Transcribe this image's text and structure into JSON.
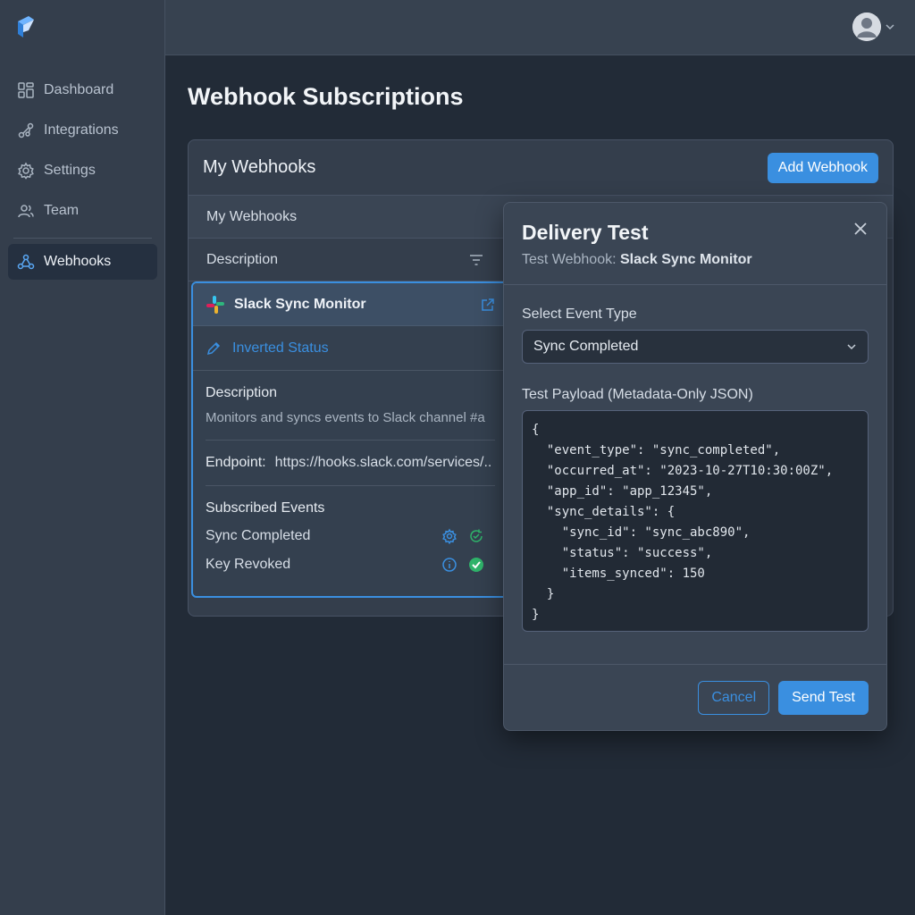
{
  "sidebar": {
    "items": [
      {
        "label": "Dashboard",
        "icon": "grid-icon"
      },
      {
        "label": "Integrations",
        "icon": "integrations-icon"
      },
      {
        "label": "Settings",
        "icon": "gear-icon"
      },
      {
        "label": "Team",
        "icon": "users-icon"
      },
      {
        "label": "Webhooks",
        "icon": "webhook-icon",
        "active": true
      }
    ]
  },
  "header": {
    "page_title": "Webhook Subscriptions"
  },
  "panel": {
    "title": "My Webhooks",
    "add_button": "Add Webhook",
    "table_header": "My Webhooks",
    "column_header": "Description"
  },
  "card": {
    "name": "Slack Sync Monitor",
    "status_label": "Inverted Status",
    "description_label": "Description",
    "description_text": "Monitors and syncs events to Slack channel #a",
    "endpoint_label": "Endpoint:",
    "endpoint_value": "https://hooks.slack.com/services/..",
    "events_label": "Subscribed Events",
    "events": [
      {
        "name": "Sync Completed"
      },
      {
        "name": "Key Revoked"
      }
    ]
  },
  "modal": {
    "title": "Delivery Test",
    "subtitle_prefix": "Test Webhook:",
    "subtitle_name": "Slack Sync Monitor",
    "event_type_label": "Select Event Type",
    "event_type_value": "Sync Completed",
    "payload_label": "Test Payload (Metadata-Only JSON)",
    "payload": "{\n  \"event_type\": \"sync_completed\",\n  \"occurred_at\": \"2023-10-27T10:30:00Z\",\n  \"app_id\": \"app_12345\",\n  \"sync_details\": {\n    \"sync_id\": \"sync_abc890\",\n    \"status\": \"success\",\n    \"items_synced\": 150\n  }\n}",
    "cancel_label": "Cancel",
    "send_label": "Send Test"
  },
  "colors": {
    "accent": "#3a8fe0",
    "success": "#2fb36a"
  }
}
